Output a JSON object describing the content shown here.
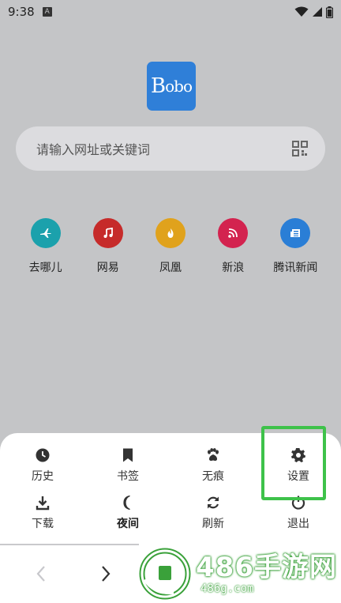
{
  "status_bar": {
    "time": "9:38",
    "notification_icon": "a-icon"
  },
  "logo": {
    "text_first": "B",
    "text_rest": "obo"
  },
  "search": {
    "placeholder": "请输入网址或关键词",
    "scan_icon": "qr-scan-icon"
  },
  "shortcuts": [
    {
      "label": "去哪儿",
      "icon": "plane-icon",
      "color": "#1ba1ac"
    },
    {
      "label": "网易",
      "icon": "music-note-icon",
      "color": "#c62b2a"
    },
    {
      "label": "凤凰",
      "icon": "phoenix-icon",
      "color": "#e0a21c"
    },
    {
      "label": "新浪",
      "icon": "rss-icon",
      "color": "#d3234f"
    },
    {
      "label": "腾讯新闻",
      "icon": "news-icon",
      "color": "#2a7ed6"
    }
  ],
  "menu": {
    "items": [
      {
        "label": "历史",
        "icon": "clock-icon"
      },
      {
        "label": "书签",
        "icon": "bookmark-icon"
      },
      {
        "label": "无痕",
        "icon": "paw-icon"
      },
      {
        "label": "设置",
        "icon": "gear-icon"
      },
      {
        "label": "下载",
        "icon": "download-icon"
      },
      {
        "label": "夜间",
        "icon": "moon-icon"
      },
      {
        "label": "刷新",
        "icon": "refresh-icon"
      },
      {
        "label": "退出",
        "icon": "power-icon"
      }
    ],
    "highlight_color": "#3ec24a"
  },
  "nav": {
    "back_icon": "chevron-left-icon",
    "forward_icon": "chevron-right-icon"
  },
  "watermark": {
    "title": "486手游网",
    "url": "486g.com"
  }
}
